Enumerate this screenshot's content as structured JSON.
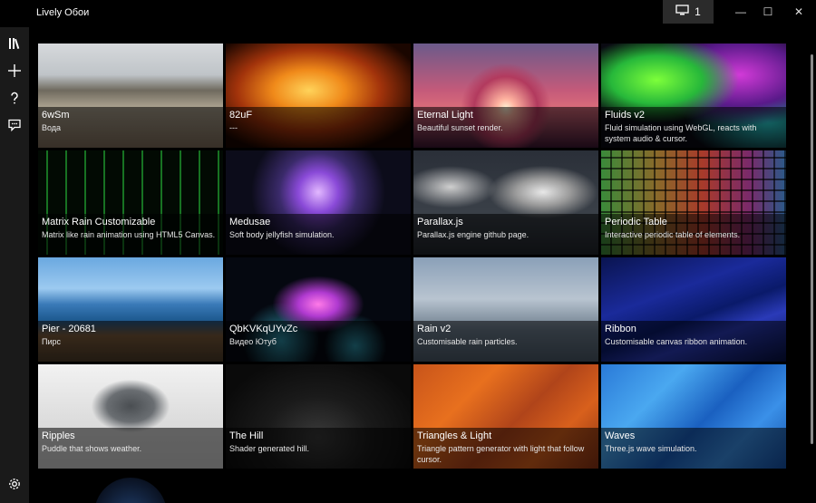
{
  "window": {
    "title": "Lively Обои",
    "monitor_count": "1",
    "controls": {
      "minimize": "—",
      "maximize": "☐",
      "close": "✕"
    }
  },
  "sidebar": {
    "items": [
      {
        "name": "library",
        "icon": "library-icon"
      },
      {
        "name": "add",
        "icon": "add-icon"
      },
      {
        "name": "help",
        "icon": "help-icon"
      },
      {
        "name": "feedback",
        "icon": "feedback-icon"
      },
      {
        "name": "settings",
        "icon": "settings-icon"
      }
    ]
  },
  "library": {
    "wallpapers": [
      {
        "title": "6wSm",
        "desc": "Вода"
      },
      {
        "title": "82uF",
        "desc": "---"
      },
      {
        "title": "Eternal Light",
        "desc": "Beautiful sunset render."
      },
      {
        "title": "Fluids v2",
        "desc": "Fluid simulation using WebGL, reacts with system audio & cursor."
      },
      {
        "title": "Matrix Rain Customizable",
        "desc": "Matrix like rain animation using HTML5 Canvas."
      },
      {
        "title": "Medusae",
        "desc": "Soft body jellyfish simulation."
      },
      {
        "title": "Parallax.js",
        "desc": "Parallax.js engine github page."
      },
      {
        "title": "Periodic Table",
        "desc": "Interactive periodic table of elements."
      },
      {
        "title": "Pier - 20681",
        "desc": "Пирс"
      },
      {
        "title": "QbKVKqUYvZc",
        "desc": "Видео Ютуб"
      },
      {
        "title": "Rain v2",
        "desc": "Customisable rain particles."
      },
      {
        "title": "Ribbon",
        "desc": "Customisable canvas ribbon animation."
      },
      {
        "title": "Ripples",
        "desc": "Puddle that shows weather."
      },
      {
        "title": "The Hill",
        "desc": "Shader generated hill."
      },
      {
        "title": "Triangles & Light",
        "desc": "Triangle pattern generator with light that follow cursor."
      },
      {
        "title": "Waves",
        "desc": "Three.js wave simulation."
      }
    ],
    "selected_index": 9
  }
}
